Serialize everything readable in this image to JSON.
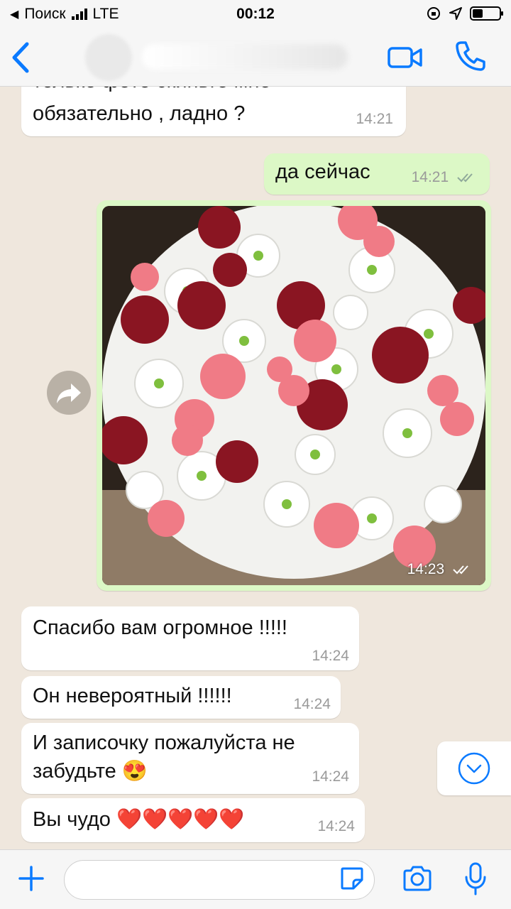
{
  "status_bar": {
    "back_app": "Поиск",
    "network": "LTE",
    "time": "00:12"
  },
  "header": {
    "contact_name": "03"
  },
  "messages": [
    {
      "direction": "in",
      "lines": [
        "только фото скиньте мне",
        "обязательно , ладно ?"
      ],
      "time": "14:21"
    },
    {
      "direction": "out",
      "text": "да сейчас",
      "time": "14:21",
      "status": "read"
    },
    {
      "direction": "out",
      "type": "photo",
      "subject": "bouquet",
      "time": "14:23",
      "status": "read"
    },
    {
      "direction": "in",
      "text": "Спасибо вам огромное !!!!!",
      "time": "14:24"
    },
    {
      "direction": "in",
      "text": "Он невероятный !!!!!!",
      "time": "14:24"
    },
    {
      "direction": "in",
      "lines": [
        "И записочку пожалуйста не",
        "забудьте 😍"
      ],
      "time": "14:24"
    },
    {
      "direction": "in",
      "text": "Вы чудо ❤️❤️❤️❤️❤️",
      "time": "14:24"
    }
  ],
  "colors": {
    "accent": "#0a7aff",
    "incoming_bubble": "#ffffff",
    "outgoing_bubble": "#dcf8c6",
    "chat_background": "#efe7dd",
    "read_ticks": "#8fa99a"
  },
  "icons": {
    "back": "chevron-left-icon",
    "video": "video-camera-icon",
    "call": "phone-icon",
    "forward": "forward-arrow-icon",
    "scroll": "chevron-down-icon",
    "plus": "plus-icon",
    "sticker": "sticker-icon",
    "camera": "camera-icon",
    "mic": "microphone-icon"
  }
}
